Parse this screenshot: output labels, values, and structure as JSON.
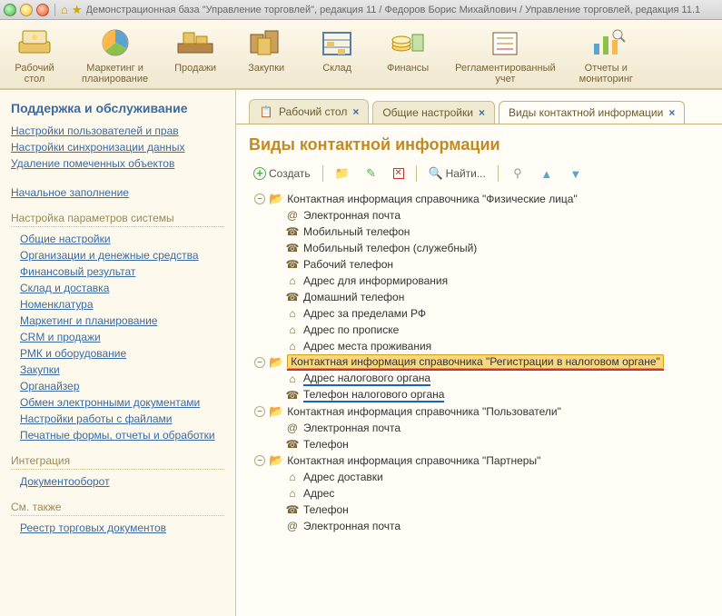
{
  "window": {
    "title": "Демонстрационная база \"Управление торговлей\", редакция 11 / Федоров Борис Михайлович / Управление торговлей, редакция 11.1"
  },
  "mainbar": [
    {
      "label": "Рабочий\nстол"
    },
    {
      "label": "Маркетинг и\nпланирование"
    },
    {
      "label": "Продажи"
    },
    {
      "label": "Закупки"
    },
    {
      "label": "Склад"
    },
    {
      "label": "Финансы"
    },
    {
      "label": "Регламентированный\nучет"
    },
    {
      "label": "Отчеты и\nмониторинг"
    }
  ],
  "leftnav": {
    "title": "Поддержка и обслуживание",
    "top_links": [
      "Настройки пользователей и прав",
      "Настройки синхронизации данных",
      "Удаление помеченных объектов"
    ],
    "link_initial": "Начальное заполнение",
    "group_params_title": "Настройка параметров системы",
    "params_links": [
      "Общие настройки",
      "Организации и денежные средства",
      "Финансовый результат",
      "Склад и доставка",
      "Номенклатура",
      "Маркетинг и планирование",
      "CRM и продажи",
      "РМК и оборудование",
      "Закупки",
      "Органайзер",
      "Обмен электронными документами",
      "Настройки работы с файлами",
      "Печатные формы, отчеты и обработки"
    ],
    "group_int_title": "Интеграция",
    "int_links": [
      "Документооборот"
    ],
    "group_see_title": "См. также",
    "see_links": [
      "Реестр торговых документов"
    ]
  },
  "tabs": [
    {
      "label": "Рабочий стол",
      "active": false,
      "icon": "desk"
    },
    {
      "label": "Общие настройки",
      "active": false
    },
    {
      "label": "Виды контактной информации",
      "active": true
    }
  ],
  "content": {
    "title": "Виды контактной информации",
    "toolbar": {
      "create": "Создать",
      "find": "Найти..."
    }
  },
  "tree": [
    {
      "lvl": 0,
      "type": "folder",
      "exp": "-",
      "text": "Контактная информация справочника \"Физические лица\""
    },
    {
      "lvl": 1,
      "type": "item",
      "icon": "@",
      "text": "Электронная почта"
    },
    {
      "lvl": 1,
      "type": "item",
      "icon": "phone",
      "text": "Мобильный телефон"
    },
    {
      "lvl": 1,
      "type": "item",
      "icon": "phone",
      "text": "Мобильный телефон (служебный)"
    },
    {
      "lvl": 1,
      "type": "item",
      "icon": "phone",
      "text": "Рабочий телефон"
    },
    {
      "lvl": 1,
      "type": "item",
      "icon": "home",
      "text": "Адрес для информирования"
    },
    {
      "lvl": 1,
      "type": "item",
      "icon": "phone",
      "text": "Домашний телефон"
    },
    {
      "lvl": 1,
      "type": "item",
      "icon": "home",
      "text": "Адрес за пределами РФ"
    },
    {
      "lvl": 1,
      "type": "item",
      "icon": "home",
      "text": "Адрес по прописке"
    },
    {
      "lvl": 1,
      "type": "item",
      "icon": "home",
      "text": "Адрес места проживания"
    },
    {
      "lvl": 0,
      "type": "folder",
      "exp": "-",
      "text": "Контактная информация справочника \"Регистрации в налоговом органе\"",
      "selected": true,
      "redline": true
    },
    {
      "lvl": 1,
      "type": "item",
      "icon": "home",
      "text": "Адрес налогового органа",
      "blueline": true
    },
    {
      "lvl": 1,
      "type": "item",
      "icon": "phone",
      "text": "Телефон налогового органа",
      "blueline": true
    },
    {
      "lvl": 0,
      "type": "folder",
      "exp": "-",
      "text": "Контактная информация справочника \"Пользователи\""
    },
    {
      "lvl": 1,
      "type": "item",
      "icon": "@",
      "text": "Электронная почта"
    },
    {
      "lvl": 1,
      "type": "item",
      "icon": "phone",
      "text": "Телефон"
    },
    {
      "lvl": 0,
      "type": "folder",
      "exp": "-",
      "text": "Контактная информация справочника \"Партнеры\""
    },
    {
      "lvl": 1,
      "type": "item",
      "icon": "home",
      "text": "Адрес доставки"
    },
    {
      "lvl": 1,
      "type": "item",
      "icon": "home",
      "text": "Адрес"
    },
    {
      "lvl": 1,
      "type": "item",
      "icon": "phone",
      "text": "Телефон"
    },
    {
      "lvl": 1,
      "type": "item",
      "icon": "@",
      "text": "Электронная почта"
    }
  ]
}
